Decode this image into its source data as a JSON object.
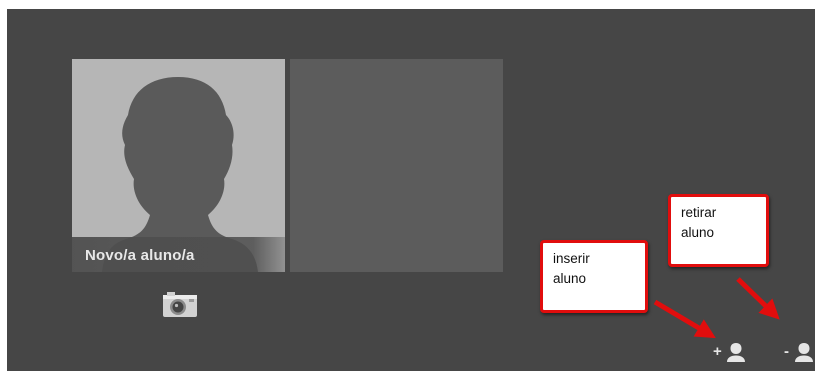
{
  "cards": [
    {
      "label": "Novo/a aluno/a",
      "icon": "person-silhouette-icon"
    },
    {
      "label": "",
      "state": "empty"
    }
  ],
  "camera": {
    "icon": "camera-icon"
  },
  "callouts": {
    "insert": {
      "line1": "inserir",
      "line2": "aluno"
    },
    "remove": {
      "line1": "retirar",
      "line2": "aluno"
    }
  },
  "actions": {
    "add": {
      "sign": "+",
      "icon": "add-user-icon"
    },
    "remove": {
      "sign": "-",
      "icon": "remove-user-icon"
    }
  },
  "colors": {
    "background": "#464646",
    "card": "#b6b6b6",
    "empty_card": "#5c5c5c",
    "callout_border": "#e10d0d",
    "arrow": "#e10d0d"
  }
}
